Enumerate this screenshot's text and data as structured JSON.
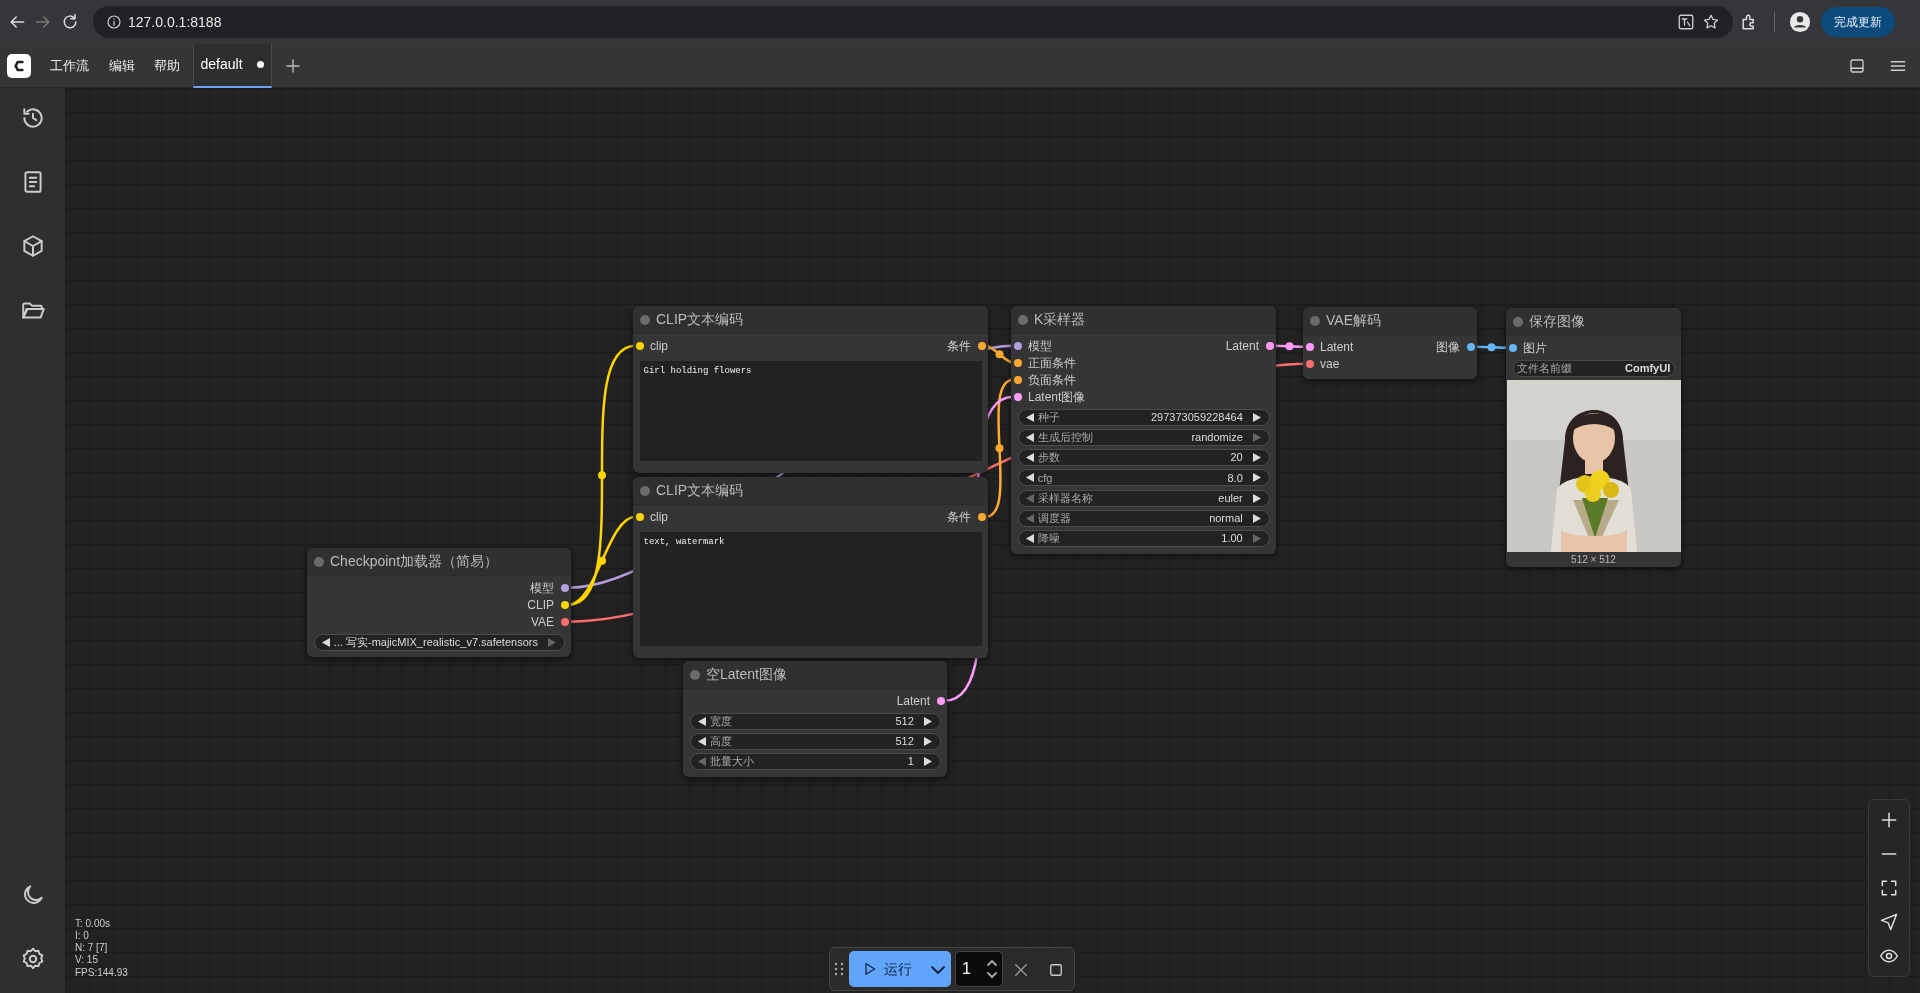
{
  "browser": {
    "url": "127.0.0.1:8188",
    "update_button": "完成更新"
  },
  "menu": [
    "工作流",
    "编辑",
    "帮助"
  ],
  "tabs": [
    {
      "label": "default",
      "selected": true,
      "unsaved": true
    }
  ],
  "nodes": [
    {
      "title": "CLIP文本编码",
      "inputs": [
        {
          "label": "clip",
          "color": "#ffd500"
        }
      ],
      "outputs": [
        {
          "label": "条件",
          "color": "#ffa931"
        }
      ],
      "text": "Girl holding flowers"
    },
    {
      "title": "K采样器",
      "inputs": [
        {
          "label": "模型",
          "color": "#b39ddb"
        },
        {
          "label": "正面条件",
          "color": "#ffa931"
        },
        {
          "label": "负面条件",
          "color": "#ffa931"
        },
        {
          "label": "Latent图像",
          "color": "#ff9cf9"
        }
      ],
      "outputs": [
        {
          "label": "Latent",
          "color": "#ff9cf9"
        }
      ],
      "widgets": [
        {
          "kind": "stepper",
          "label": "种子",
          "value": "297373059228464",
          "prev_disabled": false,
          "next_disabled": false
        },
        {
          "kind": "stepper",
          "label": "生成后控制",
          "value": "randomize",
          "prev_disabled": false,
          "next_disabled": true
        },
        {
          "kind": "stepper",
          "label": "步数",
          "value": "20",
          "prev_disabled": false,
          "next_disabled": false
        },
        {
          "kind": "stepper",
          "label": "cfg",
          "value": "8.0",
          "prev_disabled": false,
          "next_disabled": false
        },
        {
          "kind": "stepper",
          "label": "采样器名称",
          "value": "euler",
          "prev_disabled": true,
          "next_disabled": false
        },
        {
          "kind": "stepper",
          "label": "调度器",
          "value": "normal",
          "prev_disabled": true,
          "next_disabled": false
        },
        {
          "kind": "stepper",
          "label": "降噪",
          "value": "1.00",
          "prev_disabled": false,
          "next_disabled": true
        }
      ]
    },
    {
      "title": "VAE解码",
      "inputs": [
        {
          "label": "Latent",
          "color": "#ff9cf9"
        },
        {
          "label": "vae",
          "color": "#ff6e6e"
        }
      ],
      "outputs": [
        {
          "label": "图像",
          "color": "#64b5f6"
        }
      ]
    },
    {
      "title": "保存图像",
      "inputs": [
        {
          "label": "图片",
          "color": "#64b5f6"
        }
      ],
      "widgets": [
        {
          "kind": "string",
          "label": "文件名前缀",
          "value": "ComfyUI"
        }
      ],
      "image": {
        "kind": "picture"
      },
      "caption": "512 × 512"
    },
    {
      "title": "CLIP文本编码",
      "inputs": [
        {
          "label": "clip",
          "color": "#ffd500"
        }
      ],
      "outputs": [
        {
          "label": "条件",
          "color": "#ffa931"
        }
      ],
      "text": "text, watermark"
    },
    {
      "title": "Checkpoint加载器（简易）",
      "outputs": [
        {
          "label": "模型",
          "color": "#b39ddb"
        },
        {
          "label": "CLIP",
          "color": "#ffd500"
        },
        {
          "label": "VAE",
          "color": "#ff6e6e"
        }
      ],
      "widgets": [
        {
          "kind": "stepper",
          "value": "... 写实-majicMIX_realistic_v7.safetensors",
          "prev_disabled": false,
          "next_disabled": true
        }
      ]
    },
    {
      "title": "空Latent图像",
      "outputs": [
        {
          "label": "Latent",
          "color": "#ff9cf9"
        }
      ],
      "widgets": [
        {
          "kind": "stepper",
          "label": "宽度",
          "value": "512",
          "prev_disabled": false,
          "next_disabled": false
        },
        {
          "kind": "stepper",
          "label": "高度",
          "value": "512",
          "prev_disabled": false,
          "next_disabled": false
        },
        {
          "kind": "stepper",
          "label": "批量大小",
          "value": "1",
          "prev_disabled": true,
          "next_disabled": false
        }
      ]
    }
  ],
  "stats": [
    "T: 0.00s",
    "I: 0",
    "N: 7 [7]",
    "V: 15",
    "FPS:144.93"
  ],
  "run_toolbar": {
    "run_label": "运行",
    "batch_count": "1"
  }
}
